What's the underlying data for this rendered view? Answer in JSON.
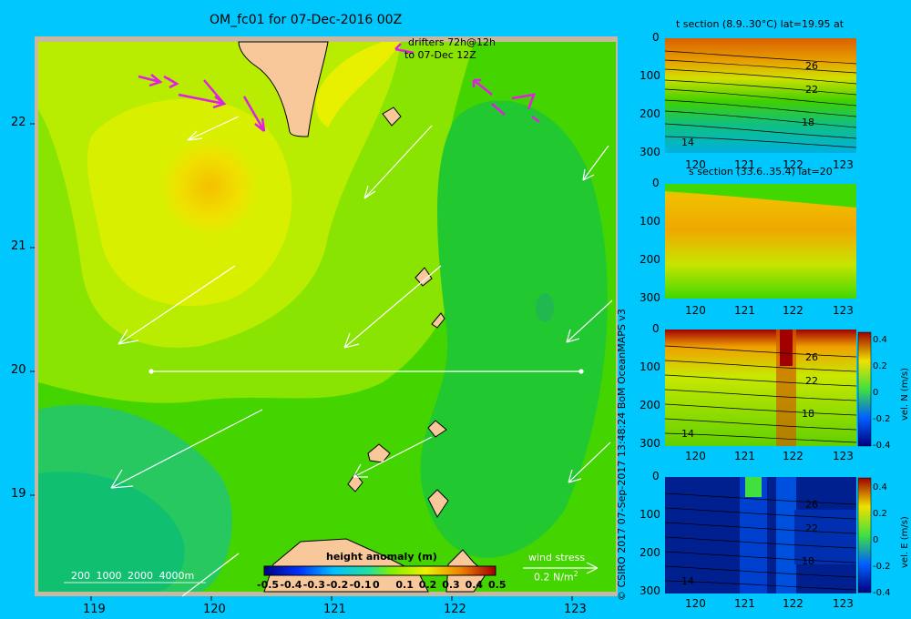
{
  "title": "OM_fc01 for 07-Dec-2016 00Z",
  "map": {
    "drifters_line1": "drifters 72h@12h",
    "drifters_line2": "to 07-Dec 12Z",
    "lon_ticks": [
      "119",
      "120",
      "121",
      "122",
      "123"
    ],
    "lat_ticks": [
      "22",
      "21",
      "20",
      "19"
    ],
    "depth_legend": "200  1000  2000  4000m",
    "colorbar_title": "height anomaly (m)",
    "colorbar_ticks": [
      "-0.5",
      "-0.4",
      "-0.3",
      "-0.2",
      "-0.1",
      "0",
      "0.1",
      "0.2",
      "0.3",
      "0.4",
      "0.5"
    ],
    "wind_title": "wind stress",
    "wind_scale": "0.2 N/m",
    "wind_scale_exp": "2"
  },
  "credit": "© CSIRO 2017   07-Sep-2017 13:48:24 BoM OceanMAPS v3",
  "panels": [
    {
      "title": "t section (8.9..30°C) lat=19.95 at",
      "yticks": [
        "0",
        "100",
        "200",
        "300"
      ],
      "xticks": [
        "120",
        "121",
        "122",
        "123"
      ],
      "contour_labels": [
        "26",
        "22",
        "18",
        "14"
      ]
    },
    {
      "title": "s section (33.6..35.4) lat=20",
      "yticks": [
        "0",
        "100",
        "200",
        "300"
      ],
      "xticks": [
        "120",
        "121",
        "122",
        "123"
      ]
    },
    {
      "yticks": [
        "0",
        "100",
        "200",
        "300"
      ],
      "xticks": [
        "120",
        "121",
        "122",
        "123"
      ],
      "contour_labels": [
        "26",
        "22",
        "18",
        "14"
      ],
      "cbar_ticks": [
        "0.4",
        "0.2",
        "0",
        "-0.2",
        "-0.4"
      ],
      "cbar_label": "vel. N (m/s)"
    },
    {
      "yticks": [
        "0",
        "100",
        "200",
        "300"
      ],
      "xticks": [
        "120",
        "121",
        "122",
        "123"
      ],
      "contour_labels": [
        "26",
        "22",
        "18",
        "14"
      ],
      "cbar_ticks": [
        "0.4",
        "0.2",
        "0",
        "-0.2",
        "-0.4"
      ],
      "cbar_label": "vel. E (m/s)"
    }
  ],
  "chart_data": [
    {
      "type": "heatmap",
      "title": "OM_fc01 for 07-Dec-2016 00Z",
      "variable": "height anomaly (m)",
      "xlim": [
        118.5,
        123.5
      ],
      "ylim": [
        18.2,
        22.7
      ],
      "color_range": [
        -0.5,
        0.5
      ],
      "section_line": {
        "lat": 20,
        "lon": [
          119.5,
          123.2
        ]
      }
    },
    {
      "type": "heatmap",
      "title": "t section (8.9..30°C) lat=19.95 at",
      "xlim": [
        119.5,
        123.2
      ],
      "ylim": [
        300,
        0
      ],
      "contours": [
        26,
        22,
        18,
        14
      ]
    },
    {
      "type": "heatmap",
      "title": "s section (33.6..35.4) lat=20",
      "xlim": [
        119.5,
        123.2
      ],
      "ylim": [
        300,
        0
      ]
    },
    {
      "type": "heatmap",
      "variable": "vel. N (m/s)",
      "xlim": [
        119.5,
        123.2
      ],
      "ylim": [
        300,
        0
      ],
      "color_range": [
        -0.4,
        0.4
      ]
    },
    {
      "type": "heatmap",
      "variable": "vel. E (m/s)",
      "xlim": [
        119.5,
        123.2
      ],
      "ylim": [
        300,
        0
      ],
      "color_range": [
        -0.4,
        0.4
      ]
    }
  ]
}
